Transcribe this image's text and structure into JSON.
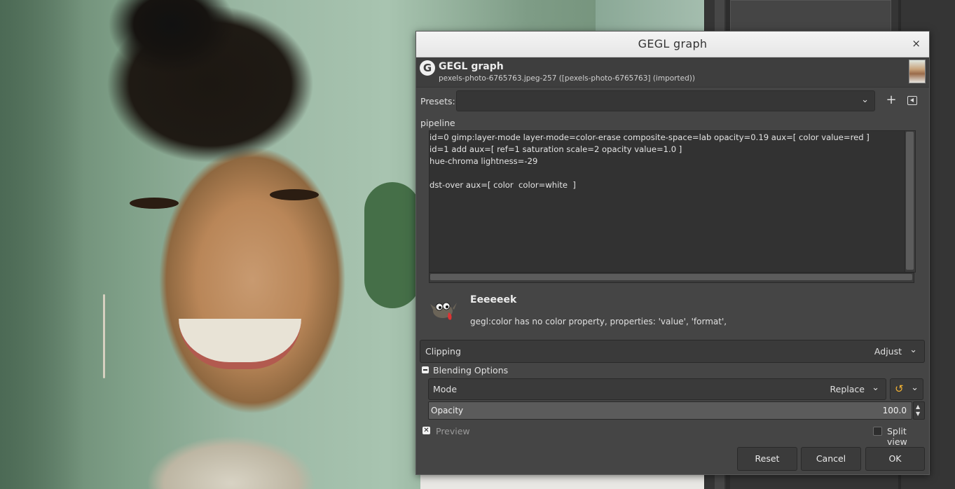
{
  "dialog": {
    "window_title": "GEGL graph",
    "close_glyph": "×",
    "header_title": "GEGL graph",
    "header_subtitle": "pexels-photo-6765763.jpeg-257 ([pexels-photo-6765763] (imported))",
    "logo_glyph": "G"
  },
  "presets": {
    "label": "Presets:",
    "value": "",
    "add_glyph": "+"
  },
  "pipeline": {
    "label": "pipeline",
    "lines": [
      "id=0 gimp:layer-mode layer-mode=color-erase composite-space=lab opacity=0.19 aux=[ color value=red ]",
      "id=1 add aux=[ ref=1 saturation scale=2 opacity value=1.0 ]",
      "hue-chroma lightness=-29",
      "",
      "dst-over aux=[ color  color=white  ]"
    ]
  },
  "message": {
    "title": "Eeeeeek",
    "text": "gegl:color has no color property, properties: 'value', 'format',"
  },
  "clipping": {
    "label": "Clipping",
    "value": "Adjust"
  },
  "blending": {
    "label": "Blending Options",
    "mode_label": "Mode",
    "mode_value": "Replace",
    "opacity_label": "Opacity",
    "opacity_value": "100.0"
  },
  "preview": {
    "label": "Preview",
    "checked_glyph": "✕",
    "split_label": "Split view"
  },
  "buttons": {
    "reset": "Reset",
    "cancel": "Cancel",
    "ok": "OK"
  },
  "icons": [
    "close-icon",
    "gegl-logo-icon",
    "image-thumbnail-icon",
    "chevron-down-icon",
    "add-preset-icon",
    "preset-menu-icon",
    "wilber-icon",
    "reset-mode-icon",
    "spin-up-icon",
    "spin-down-icon"
  ],
  "colors": {
    "dialog_bg": "#454545",
    "titlebar_bg": "#f0f0f0",
    "reset_icon": "#f2b233"
  }
}
